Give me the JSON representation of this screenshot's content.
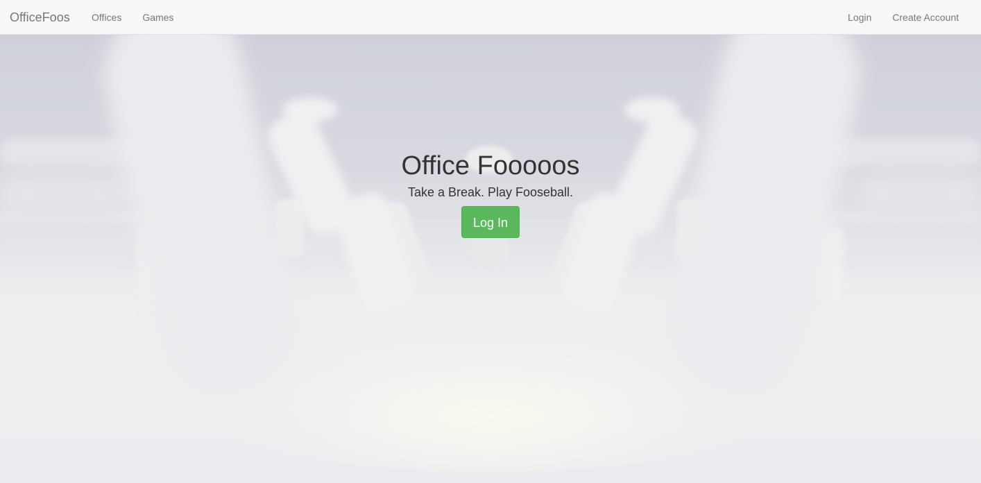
{
  "navbar": {
    "brand": "OfficeFoos",
    "left_links": [
      "Offices",
      "Games"
    ],
    "right_links": [
      "Login",
      "Create Account"
    ]
  },
  "hero": {
    "title": "Office Fooooos",
    "subtitle": "Take a Break. Play Fooseball.",
    "cta_label": "Log In",
    "background_image": "blurred-foosball-table",
    "cta_color": "#5cb85c"
  }
}
